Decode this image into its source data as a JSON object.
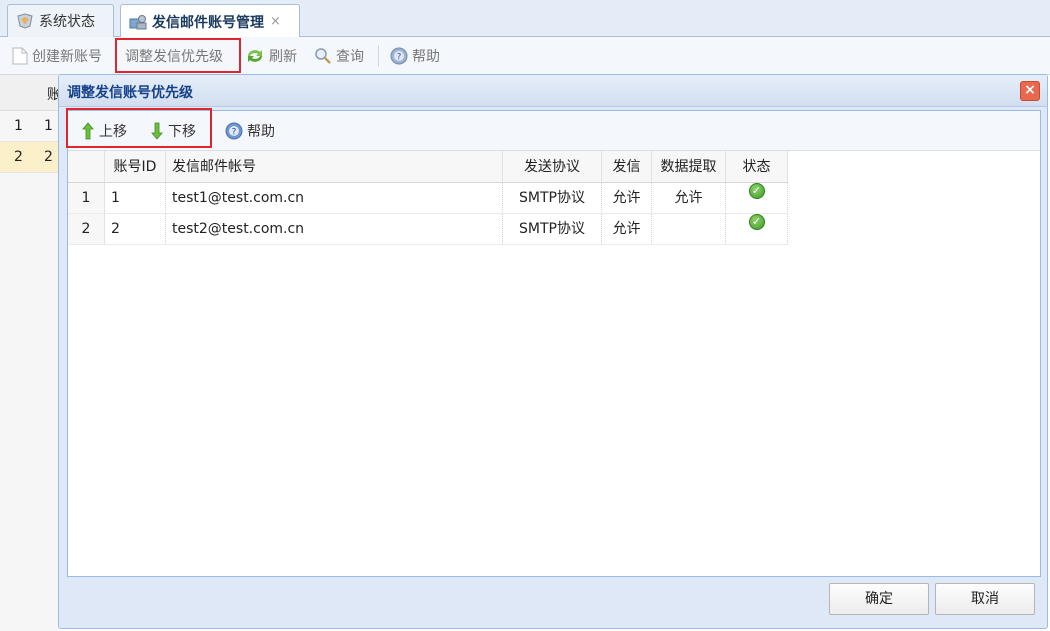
{
  "tabs": [
    {
      "label": "系统状态",
      "icon": "system-status-icon",
      "active": false
    },
    {
      "label": "发信邮件账号管理",
      "icon": "mail-account-icon",
      "active": true,
      "close": "×"
    }
  ],
  "toolbar": {
    "create_label": "创建新账号",
    "priority_label": "调整发信优先级",
    "refresh_label": "刷新",
    "search_label": "查询",
    "help_label": "帮助"
  },
  "background_grid": {
    "header_partial": "账",
    "rows": [
      {
        "rownum": "1",
        "id": "1"
      },
      {
        "rownum": "2",
        "id": "2"
      }
    ]
  },
  "dialog": {
    "title": "调整发信账号优先级",
    "close": "×",
    "toolbar": {
      "up_label": "上移",
      "down_label": "下移",
      "help_label": "帮助"
    },
    "columns": [
      "账号ID",
      "发信邮件帐号",
      "发送协议",
      "发信",
      "数据提取",
      "状态"
    ],
    "rows": [
      {
        "rownum": "1",
        "id": "1",
        "account": "test1@test.com.cn",
        "protocol": "SMTP协议",
        "send": "允许",
        "extract": "允许",
        "status": "enabled"
      },
      {
        "rownum": "2",
        "id": "2",
        "account": "test2@test.com.cn",
        "protocol": "SMTP协议",
        "send": "允许",
        "extract": "",
        "status": "enabled"
      }
    ],
    "confirm_label": "确定",
    "cancel_label": "取消"
  },
  "colors": {
    "highlight_box": "#e0252d",
    "dialog_title": "#15428b",
    "status_ok": "#3d9a2a"
  }
}
